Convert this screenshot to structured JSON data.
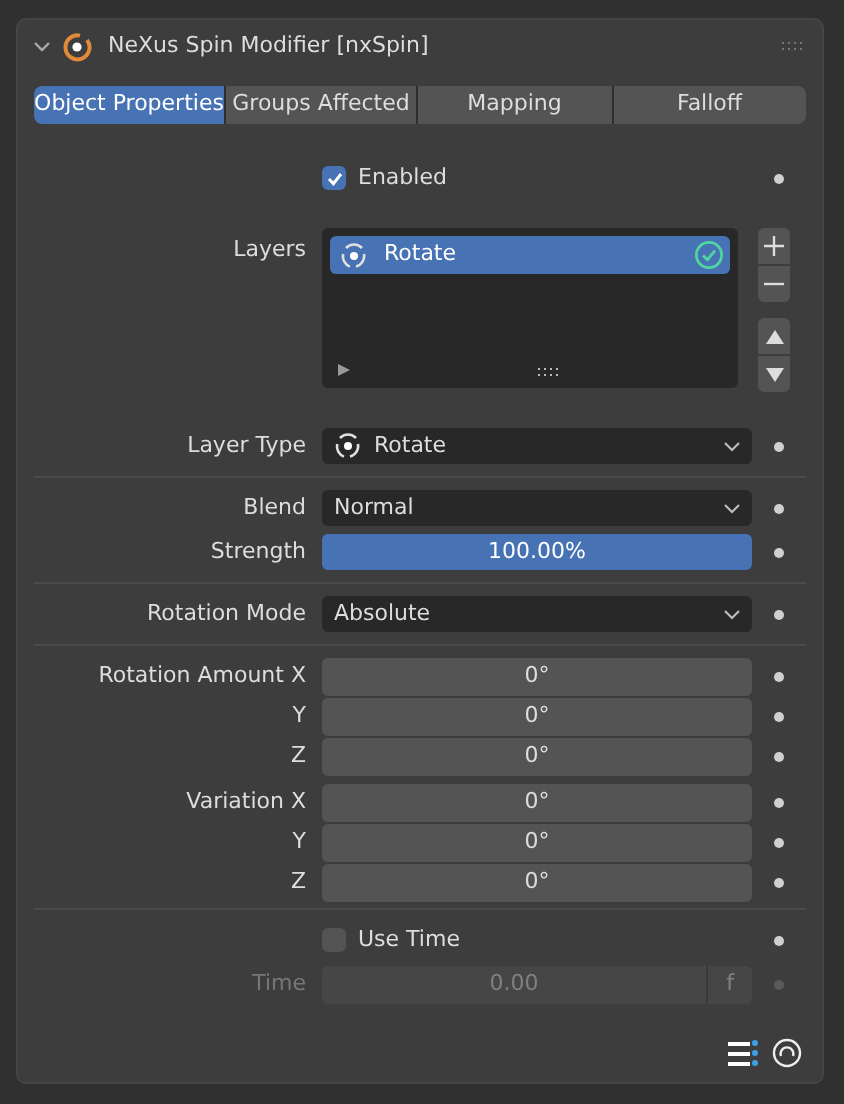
{
  "header": {
    "title": "NeXus Spin Modifier [nxSpin]",
    "expanded": true
  },
  "tabs": [
    {
      "label": "Object Properties",
      "selected": true
    },
    {
      "label": "Groups Affected",
      "selected": false
    },
    {
      "label": "Mapping",
      "selected": false
    },
    {
      "label": "Falloff",
      "selected": false
    }
  ],
  "groups": [
    [
      {
        "kind": "checkbox",
        "label": "Enabled",
        "checked": true
      },
      {
        "kind": "layer_list",
        "label": "Layers",
        "items": [
          {
            "name": "Rotate",
            "selected": true,
            "enabled": true
          }
        ]
      },
      {
        "kind": "layer_dropdown",
        "label": "Layer Type",
        "value": "Rotate"
      }
    ],
    [
      {
        "kind": "dropdown",
        "label": "Blend",
        "value": "Normal"
      },
      {
        "kind": "slider",
        "label": "Strength",
        "value": "100.00%",
        "level": 1
      }
    ],
    [
      {
        "kind": "dropdown",
        "label": "Rotation Mode",
        "value": "Absolute"
      }
    ],
    [
      {
        "kind": "number",
        "label": "Rotation Amount X",
        "value": "0°"
      },
      {
        "kind": "number",
        "label": "Y",
        "value": "0°"
      },
      {
        "kind": "number",
        "label": "Z",
        "value": "0°",
        "gap_after": true
      },
      {
        "kind": "number",
        "label": "Variation X",
        "value": "0°"
      },
      {
        "kind": "number",
        "label": "Y",
        "value": "0°"
      },
      {
        "kind": "number",
        "label": "Z",
        "value": "0°"
      }
    ],
    [
      {
        "kind": "checkbox",
        "label": "Use Time",
        "checked": false
      },
      {
        "kind": "number",
        "label": "Time",
        "value": "0.00",
        "unit": "f",
        "disabled": true
      }
    ]
  ]
}
